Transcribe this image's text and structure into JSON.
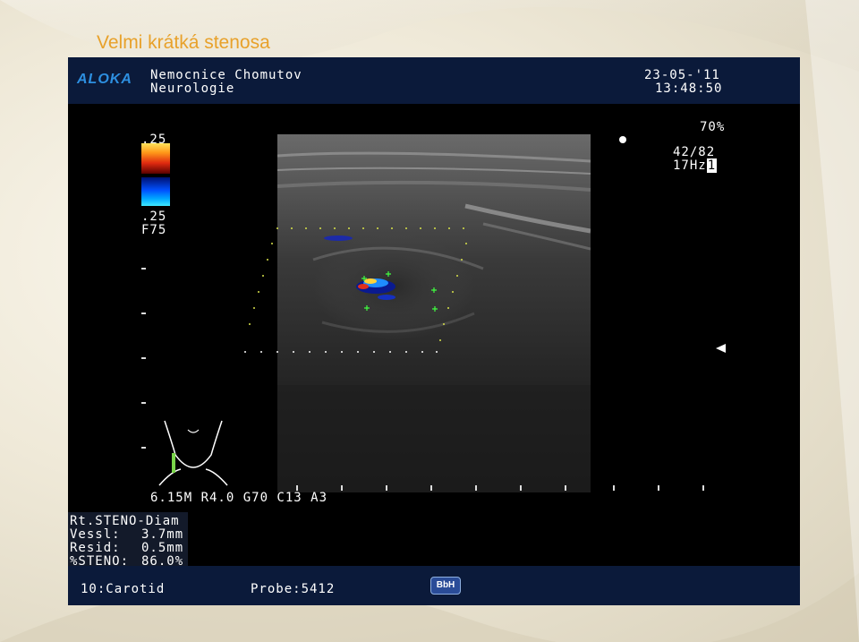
{
  "slide": {
    "title": "Velmi krátká stenosa"
  },
  "header": {
    "brand": "ALOKA",
    "institution": "Nemocnice Chomutov",
    "department": "Neurologie",
    "date": "23-05-'11",
    "time": "13:48:50"
  },
  "settings": {
    "power": "70%",
    "fps": "42/82",
    "frequency": "17Hz",
    "frequency_box": "1"
  },
  "color_scale": {
    "top_value": ".25",
    "bottom_value": ".25",
    "filter": "F75"
  },
  "parameters": "6.15M R4.0 G70 C13 A3",
  "measurements": {
    "title": "Rt.STENO-Diam",
    "rows": [
      {
        "label": "Vessl:",
        "value": "3.7mm"
      },
      {
        "label": "Resid:",
        "value": "0.5mm"
      },
      {
        "label": "%STENO:",
        "value": "86.0%"
      }
    ]
  },
  "footer": {
    "preset": "10:Carotid",
    "probe": "Probe:5412",
    "badge": "BbH"
  },
  "colors": {
    "title": "#e8a12a",
    "header_bar": "#0b1a3a",
    "logo": "#2d8fe0",
    "screen_bg": "#000000"
  }
}
